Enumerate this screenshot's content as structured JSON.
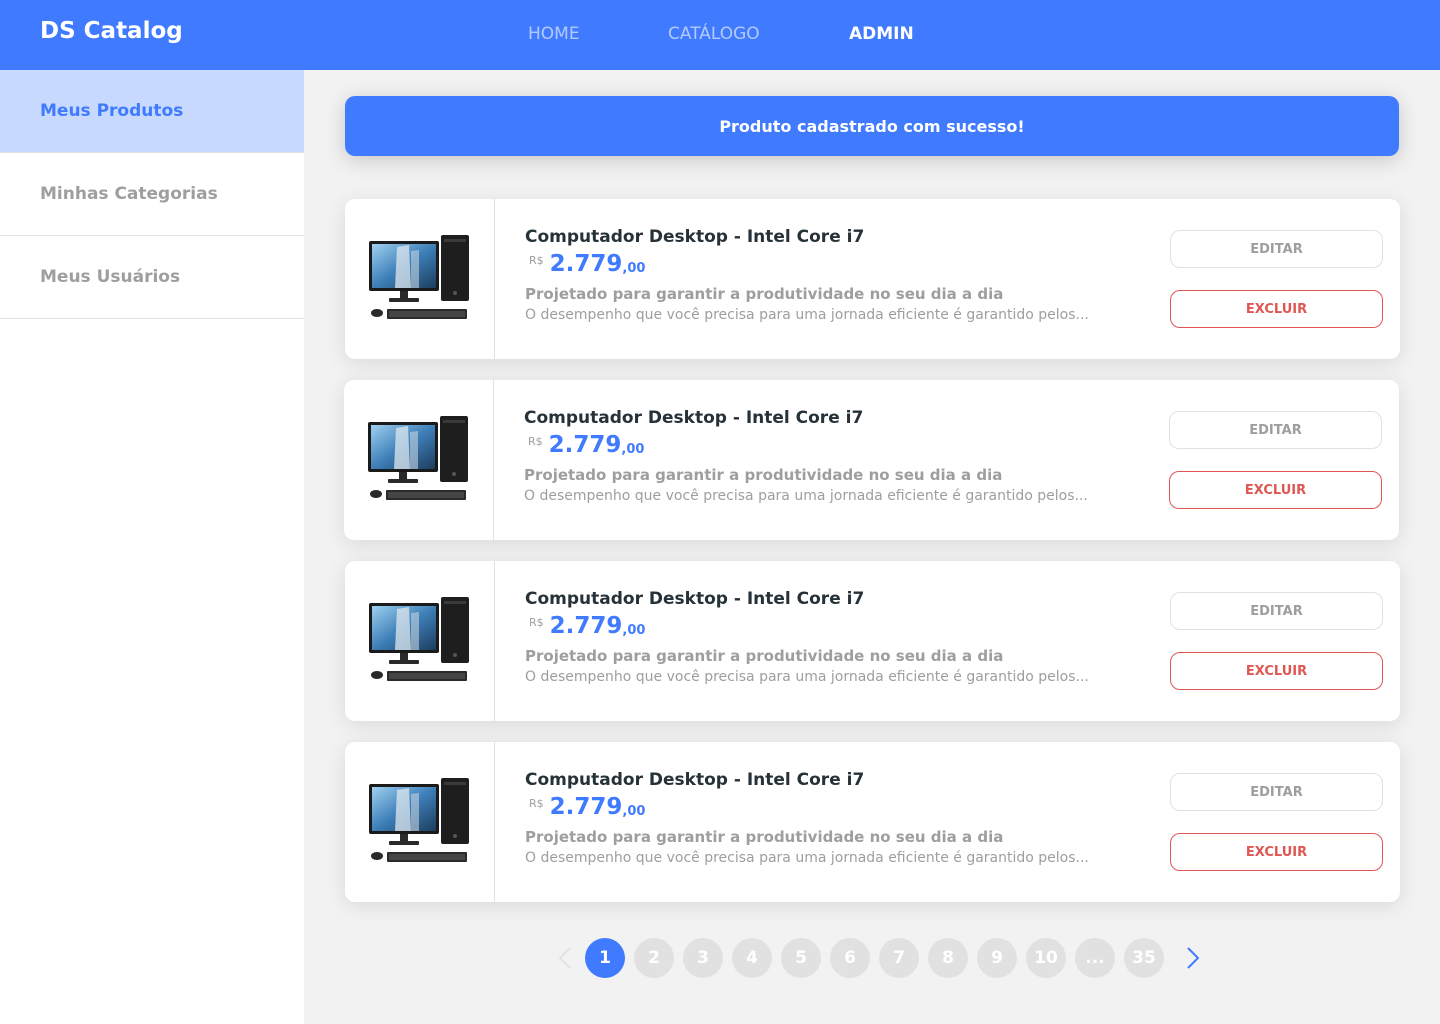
{
  "header": {
    "brand": "DS Catalog",
    "nav": [
      {
        "label": "HOME"
      },
      {
        "label": "CATÁLOGO"
      },
      {
        "label": "ADMIN"
      }
    ],
    "active_nav": "ADMIN"
  },
  "sidebar": {
    "items": [
      {
        "label": "Meus Produtos"
      },
      {
        "label": "Minhas Categorias"
      },
      {
        "label": "Meus Usuários"
      }
    ],
    "active_item": "Meus Produtos"
  },
  "alert": {
    "message": "Produto cadastrado com sucesso!"
  },
  "products": [
    {
      "name": "Computador Desktop - Intel Core i7",
      "currency": "R$",
      "price_int": "2.779",
      "price_cents": ",00",
      "subtitle": "Projetado para garantir a produtividade no seu dia a dia",
      "description": "O desempenho que você precisa para uma jornada eficiente é garantido pelos...",
      "edit_label": "EDITAR",
      "delete_label": "EXCLUIR",
      "image_icon": "desktop-computer-icon"
    },
    {
      "name": "Computador Desktop - Intel Core i7",
      "currency": "R$",
      "price_int": "2.779",
      "price_cents": ",00",
      "subtitle": "Projetado para garantir a produtividade no seu dia a dia",
      "description": "O desempenho que você precisa para uma jornada eficiente é garantido pelos...",
      "edit_label": "EDITAR",
      "delete_label": "EXCLUIR",
      "image_icon": "desktop-computer-icon"
    },
    {
      "name": "Computador Desktop - Intel Core i7",
      "currency": "R$",
      "price_int": "2.779",
      "price_cents": ",00",
      "subtitle": "Projetado para garantir a produtividade no seu dia a dia",
      "description": "O desempenho que você precisa para uma jornada eficiente é garantido pelos...",
      "edit_label": "EDITAR",
      "delete_label": "EXCLUIR",
      "image_icon": "desktop-computer-icon"
    },
    {
      "name": "Computador Desktop - Intel Core i7",
      "currency": "R$",
      "price_int": "2.779",
      "price_cents": ",00",
      "subtitle": "Projetado para garantir a produtividade no seu dia a dia",
      "description": "O desempenho que você precisa para uma jornada eficiente é garantido pelos...",
      "edit_label": "EDITAR",
      "delete_label": "EXCLUIR",
      "image_icon": "desktop-computer-icon"
    }
  ],
  "pagination": {
    "pages": [
      "1",
      "2",
      "3",
      "4",
      "5",
      "6",
      "7",
      "8",
      "9",
      "10",
      "...",
      "35"
    ],
    "current": "1",
    "prev_icon": "chevron-left-icon",
    "next_icon": "chevron-right-icon"
  },
  "colors": {
    "primary": "#407bff",
    "sidebar_active_bg": "#c7d9ff",
    "danger": "#df5753",
    "muted": "#9e9e9e",
    "page_bg": "#f2f2f2"
  }
}
